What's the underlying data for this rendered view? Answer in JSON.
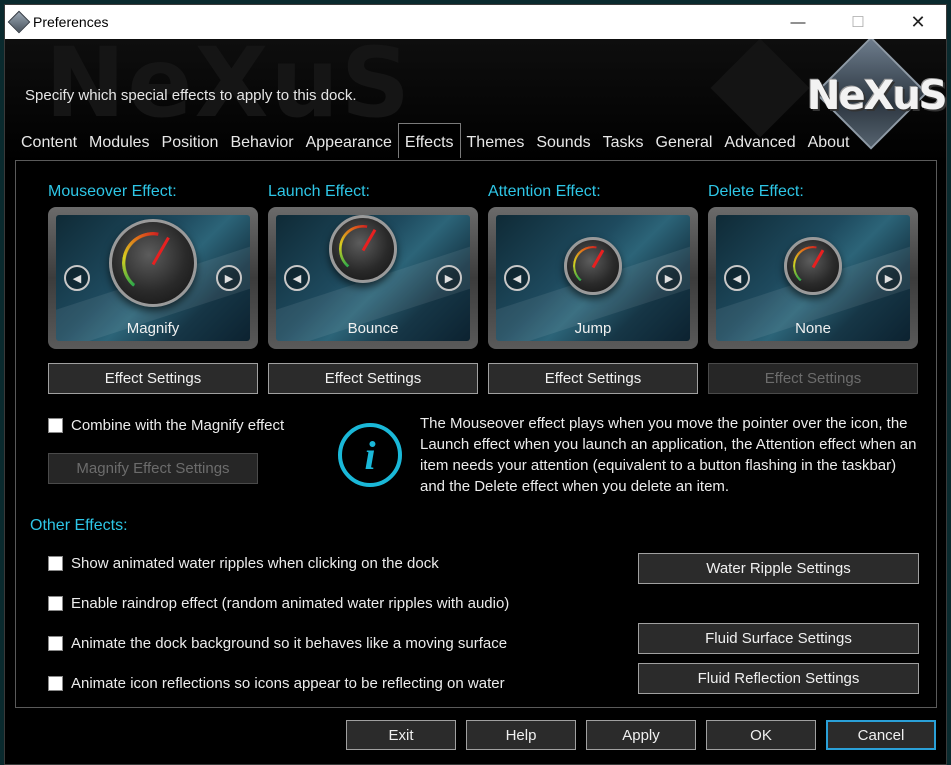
{
  "window": {
    "title": "Preferences",
    "minimize_glyph": "—",
    "maximize_glyph": "☐",
    "close_glyph": "✕"
  },
  "header": {
    "subtitle": "Specify which special effects to apply to this dock.",
    "logo_text": "NeXuS",
    "watermark_text": "NeXuS"
  },
  "tabs": [
    "Content",
    "Modules",
    "Position",
    "Behavior",
    "Appearance",
    "Effects",
    "Themes",
    "Sounds",
    "Tasks",
    "General",
    "Advanced",
    "About"
  ],
  "active_tab": "Effects",
  "effects": [
    {
      "label": "Mouseover Effect:",
      "value": "Magnify",
      "button": "Effect Settings",
      "button_enabled": true
    },
    {
      "label": "Launch Effect:",
      "value": "Bounce",
      "button": "Effect Settings",
      "button_enabled": true
    },
    {
      "label": "Attention Effect:",
      "value": "Jump",
      "button": "Effect Settings",
      "button_enabled": true
    },
    {
      "label": "Delete Effect:",
      "value": "None",
      "button": "Effect Settings",
      "button_enabled": false
    }
  ],
  "arrows": {
    "prev": "◀",
    "next": "▶"
  },
  "combine": {
    "label": "Combine with the Magnify effect",
    "checked": false,
    "button": "Magnify Effect Settings"
  },
  "info": {
    "icon": "i",
    "text": "The Mouseover effect plays when you move the pointer over the icon, the Launch effect when you launch an application, the Attention effect when an item needs your attention (equivalent to a button flashing in the taskbar) and the Delete effect when you delete an item."
  },
  "other_effects": {
    "heading": "Other Effects:",
    "options": [
      {
        "label": "Show animated water ripples when clicking on the dock",
        "checked": false
      },
      {
        "label": "Enable raindrop effect (random animated water ripples with audio)",
        "checked": false
      },
      {
        "label": "Animate the dock background so it behaves like a moving surface",
        "checked": false
      },
      {
        "label": "Animate icon reflections so icons appear to be reflecting on water",
        "checked": false
      }
    ],
    "buttons": {
      "water_ripple": "Water Ripple Settings",
      "fluid_surface": "Fluid Surface Settings",
      "fluid_reflection": "Fluid Reflection Settings"
    }
  },
  "footer": {
    "exit": "Exit",
    "help": "Help",
    "apply": "Apply",
    "ok": "OK",
    "cancel": "Cancel"
  },
  "colors": {
    "accent": "#2ec6e6",
    "background": "#000000",
    "focus_border": "#2aa0d8"
  }
}
